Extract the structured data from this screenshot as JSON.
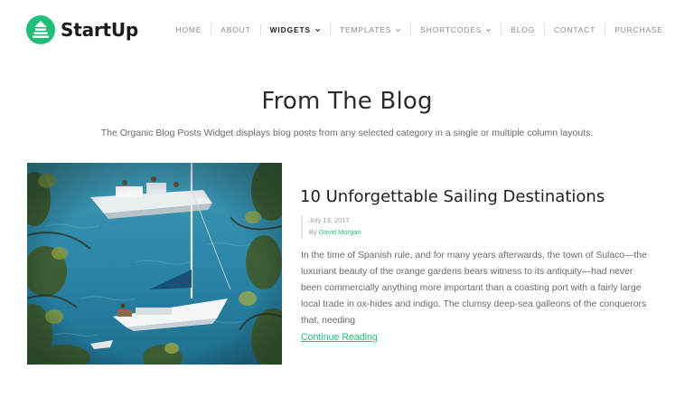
{
  "brand": {
    "name": "StartUp",
    "accent": "#1fbf7a",
    "logo_icon": "lighthouse-logo-icon"
  },
  "nav": {
    "items": [
      {
        "label": "HOME",
        "active": false,
        "dropdown": false
      },
      {
        "label": "ABOUT",
        "active": false,
        "dropdown": false
      },
      {
        "label": "WIDGETS",
        "active": true,
        "dropdown": true
      },
      {
        "label": "TEMPLATES",
        "active": false,
        "dropdown": true
      },
      {
        "label": "SHORTCODES",
        "active": false,
        "dropdown": true
      },
      {
        "label": "BLOG",
        "active": false,
        "dropdown": false
      },
      {
        "label": "CONTACT",
        "active": false,
        "dropdown": false
      },
      {
        "label": "PURCHASE",
        "active": false,
        "dropdown": false
      }
    ]
  },
  "section": {
    "title": "From The Blog",
    "subtitle": "The Organic Blog Posts Widget displays blog posts from any selected category in a single or multiple column layouts."
  },
  "post": {
    "image_alt": "sailboat-photo",
    "title": "10 Unforgettable Sailing Destinations",
    "date": "July 13, 2017",
    "by_label": "By",
    "author": "David Morgan",
    "excerpt": "In the time of Spanish rule, and for many years afterwards, the town of Sulaco—the luxuriant beauty of the orange gardens bears witness to its antiquity—had never been commercially anything more important than a coasting port with a fairly large local trade in ox-hides and indigo. The clumsy deep-sea galleons of the conquerors that, needing",
    "read_more": "Continue Reading"
  }
}
